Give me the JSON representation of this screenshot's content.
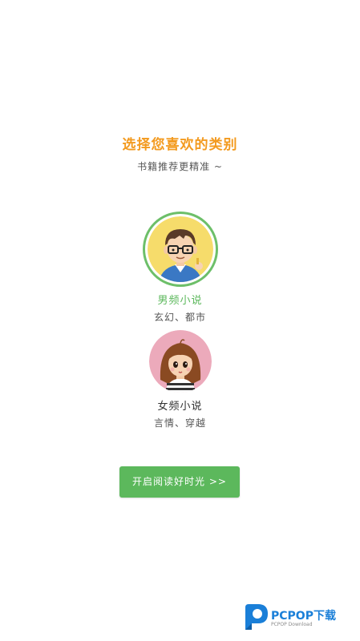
{
  "header": {
    "title": "选择您喜欢的类别",
    "subtitle": "书籍推荐更精准 ~"
  },
  "categories": [
    {
      "name": "男频小说",
      "desc": "玄幻、都市",
      "selected": true
    },
    {
      "name": "女频小说",
      "desc": "言情、穿越",
      "selected": false
    }
  ],
  "start_button": {
    "label": "开启阅读好时光 >>"
  },
  "watermark": {
    "brand": "PCPOP下载",
    "sub": "PCPOP Download"
  },
  "colors": {
    "accent_orange": "#f39a1f",
    "accent_green": "#5cb85c",
    "watermark_blue": "#1a7fd8"
  }
}
